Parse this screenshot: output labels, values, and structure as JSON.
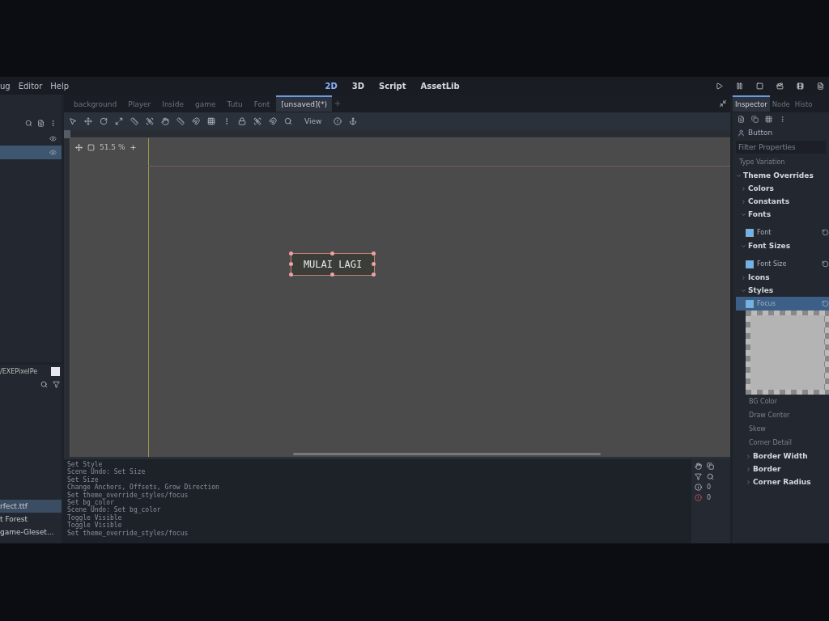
{
  "menu": {
    "items": [
      "ug",
      "Editor",
      "Help"
    ]
  },
  "workspaces": [
    {
      "label": "2D",
      "selected": true
    },
    {
      "label": "3D",
      "selected": false
    },
    {
      "label": "Script",
      "selected": false
    },
    {
      "label": "AssetLib",
      "selected": false
    }
  ],
  "scene_tabs": [
    {
      "label": "background",
      "selected": false
    },
    {
      "label": "Player",
      "selected": false
    },
    {
      "label": "Inside",
      "selected": false
    },
    {
      "label": "game",
      "selected": false
    },
    {
      "label": "Tutu",
      "selected": false
    },
    {
      "label": "Font",
      "selected": false
    },
    {
      "label": "[unsaved](*)",
      "selected": true
    }
  ],
  "toolbar": {
    "view_menu": "View"
  },
  "scene_dock": {
    "rows": [
      {
        "selected": false
      },
      {
        "selected": true
      }
    ]
  },
  "filesystem": {
    "path": "/EXEPixelPe",
    "files": [
      {
        "name": "rfect.ttf",
        "selected": true
      },
      {
        "name": "t Forest",
        "selected": false
      },
      {
        "name": "game-Gleset...",
        "selected": false
      }
    ]
  },
  "viewport": {
    "zoom": "51.5 %",
    "canvas_button": "MULAI LAGI"
  },
  "output": {
    "lines": [
      "Set Style",
      "Scene Undo: Set Size",
      "Set Size",
      "Change Anchors, Offsets, Grow Direction",
      "Set theme_override_styles/focus",
      "Set bg_color",
      "Scene Undo: Set bg_color",
      "Toggle Visible",
      "Toggle Visible",
      "Set theme_override_styles/focus"
    ],
    "counts": [
      "0",
      "0"
    ]
  },
  "inspector": {
    "tabs": [
      {
        "label": "Inspector",
        "selected": true
      },
      {
        "label": "Node",
        "selected": false
      },
      {
        "label": "Histo",
        "selected": false
      }
    ],
    "node": "Button",
    "filter_placeholder": "Filter Properties",
    "properties": [
      {
        "kind": "field",
        "label": "Type Variation"
      },
      {
        "kind": "group",
        "label": "Theme Overrides",
        "expanded": true,
        "children": [
          {
            "kind": "group",
            "label": "Colors",
            "expanded": false
          },
          {
            "kind": "group",
            "label": "Constants",
            "expanded": false
          },
          {
            "kind": "group",
            "label": "Fonts",
            "expanded": true,
            "children": [
              {
                "kind": "check",
                "label": "Font",
                "checked": true,
                "selected": false
              }
            ]
          },
          {
            "kind": "group",
            "label": "Font Sizes",
            "expanded": true,
            "children": [
              {
                "kind": "check",
                "label": "Font Size",
                "checked": true,
                "selected": false
              }
            ]
          },
          {
            "kind": "group",
            "label": "Icons",
            "expanded": false
          },
          {
            "kind": "group",
            "label": "Styles",
            "expanded": true,
            "children": [
              {
                "kind": "check",
                "label": "Focus",
                "checked": true,
                "selected": true
              },
              {
                "kind": "preview"
              },
              {
                "kind": "field",
                "label": "BG Color"
              },
              {
                "kind": "field",
                "label": "Draw Center"
              },
              {
                "kind": "field",
                "label": "Skew"
              },
              {
                "kind": "field",
                "label": "Corner Detail"
              },
              {
                "kind": "group",
                "label": "Border Width",
                "expanded": false
              },
              {
                "kind": "group",
                "label": "Border",
                "expanded": false
              },
              {
                "kind": "group",
                "label": "Corner Radius",
                "expanded": false
              }
            ]
          }
        ]
      }
    ]
  }
}
